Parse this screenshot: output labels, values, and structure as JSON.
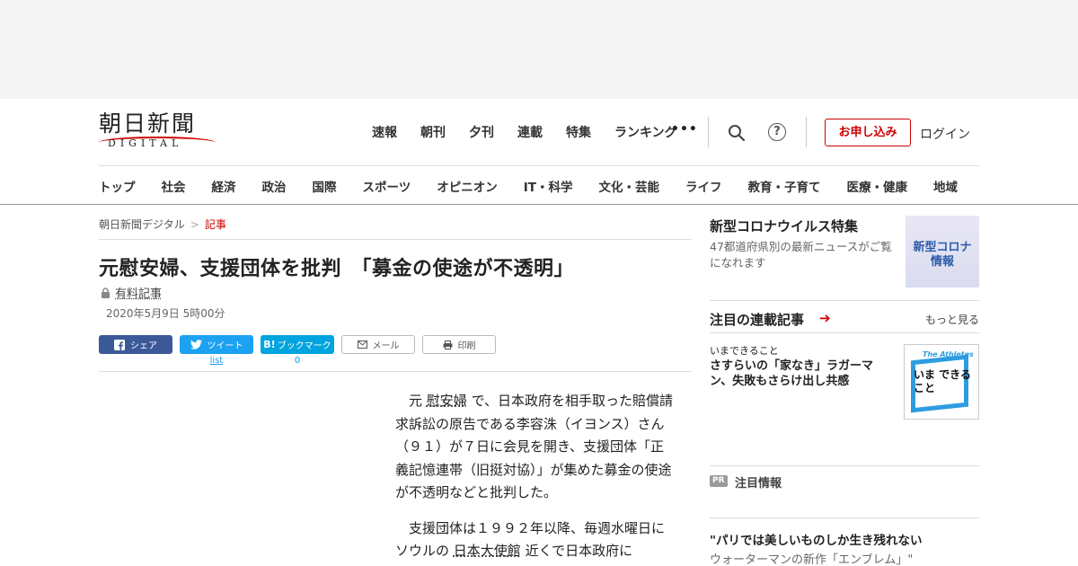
{
  "header": {
    "logo_main": "朝日新聞",
    "logo_sub": "DIGITAL",
    "top_nav": [
      "速報",
      "朝刊",
      "夕刊",
      "連載",
      "特集",
      "ランキング"
    ],
    "more": "•••",
    "apply_label": "お申し込み",
    "login_label": "ログイン",
    "categories": [
      "トップ",
      "社会",
      "経済",
      "政治",
      "国際",
      "スポーツ",
      "オピニオン",
      "IT・科学",
      "文化・芸能",
      "ライフ",
      "教育・子育て",
      "医療・健康",
      "地域"
    ]
  },
  "breadcrumb": {
    "home": "朝日新聞デジタル",
    "sep": ">",
    "current": "記事"
  },
  "article": {
    "title": "元慰安婦、支援団体を批判　「募金の使途が不透明」",
    "paid_label": "有料記事",
    "date": "2020年5月9日 5時00分",
    "share": {
      "facebook": "シェア",
      "twitter": "ツイート",
      "twitter_count": "list",
      "hatena": "ブックマーク",
      "hatena_count": "0",
      "mail": "メール",
      "print": "印刷"
    },
    "p1_a": "元 ",
    "p1_link": "慰安婦",
    "p1_b": " で、日本政府を相手取った賠償請求訴訟の原告である李容洙（イヨンス）さん（９１）が７日に会見を開き、支援団体「正義記憶連帯（旧挺対協）」が集めた募金の使途が不透明などと批判した。",
    "p2_a": "支援団体は１９９２年以降、毎週水曜日にソウルの ",
    "p2_link": "日本大使館",
    "p2_b": " 近くで日本政府に"
  },
  "sidebar": {
    "corona_title": "新型コロナウイルス特集",
    "corona_desc": "47都道府県別の最新ニュースがご覧になれます",
    "corona_thumb": "新型コロナ 情報",
    "series_title": "注目の連載記事",
    "see_more": "もっと見る",
    "series_kicker": "いまできること",
    "series_head": "さすらいの「家なき」ラガーマン、失敗もさらけ出し共感",
    "series_thumb_top": "The Athletes",
    "series_thumb_main": "いま できること",
    "pr_badge": "PR",
    "pr_label": "注目情報",
    "promo_head": "\"パリでは美しいものしか生き残れない",
    "promo_sub": "ウォーターマンの新作「エンブレム」\""
  }
}
